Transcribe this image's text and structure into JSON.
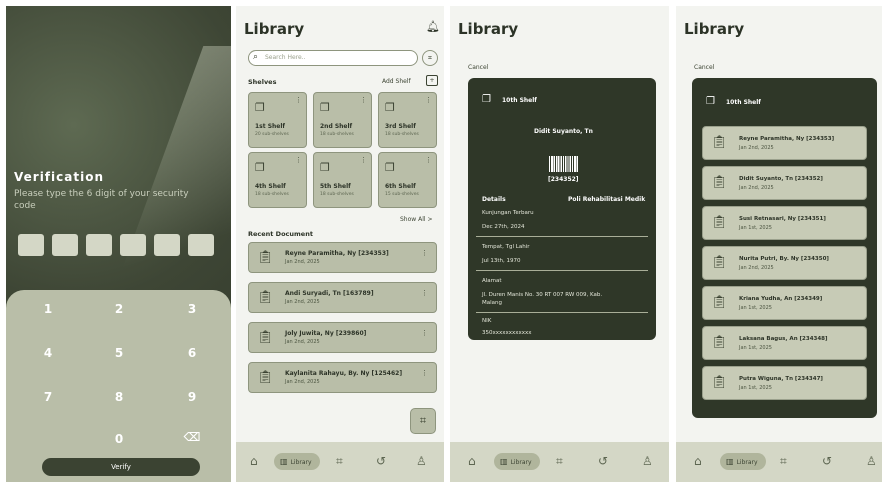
{
  "colors": {
    "dark": "#2f3728",
    "sage": "#b9bea8",
    "light": "#f3f4f0"
  },
  "verification": {
    "title": "Verification",
    "subtitle": "Please type the 6 digit of your security code",
    "keys": [
      "1",
      "2",
      "3",
      "4",
      "5",
      "6",
      "7",
      "8",
      "9",
      "0"
    ],
    "backspace_icon": "⌫",
    "verify_label": "Verify"
  },
  "library": {
    "title": "Library",
    "bell_icon": "♫",
    "search_placeholder": "Search Here..",
    "shelves_label": "Shelves",
    "add_shelf_label": "Add Shelf",
    "shelves": [
      {
        "name": "1st Shelf",
        "sub": "20 sub-shelves"
      },
      {
        "name": "2nd Shelf",
        "sub": "18 sub-shelves"
      },
      {
        "name": "3rd Shelf",
        "sub": "18 sub-shelves"
      },
      {
        "name": "4th Shelf",
        "sub": "18 sub-shelves"
      },
      {
        "name": "5th Shelf",
        "sub": "18 sub-shelves"
      },
      {
        "name": "6th Shelf",
        "sub": "15 sub-shelves"
      }
    ],
    "show_all_label": "Show All >",
    "recent_label": "Recent Document",
    "recent": [
      {
        "name": "Reyne Paramitha, Ny [234353]",
        "date": "Jan 2nd, 2025"
      },
      {
        "name": "Andi Suryadi, Tn [163789]",
        "date": "Jan 2nd, 2025"
      },
      {
        "name": "Joly Juwita, Ny [239860]",
        "date": "Jan 2nd, 2025"
      },
      {
        "name": "Kaylanita Rahayu, By. Ny [125462]",
        "date": "Jan 2nd, 2025"
      }
    ]
  },
  "nav": {
    "library_label": "Library"
  },
  "detail": {
    "cancel": "Cancel",
    "shelf_name": "10th Shelf",
    "patient": "Didit Suyanto, Tn",
    "code": "[234352]",
    "details_label": "Details",
    "department": "Poli Rehabilitasi Medik",
    "fields": [
      {
        "label": "Kunjungan Terbaru",
        "value": "Dec 27th, 2024"
      },
      {
        "label": "Tempat, Tgl Lahir",
        "value": "Jul 13th, 1970"
      },
      {
        "label": "Alamat",
        "value": "Jl. Duren Manis No. 30 RT 007 RW 009, Kab.",
        "value2": "Malang"
      },
      {
        "label": "NIK",
        "value": "350xxxxxxxxxxxx"
      }
    ]
  },
  "shelf_list": {
    "cancel": "Cancel",
    "shelf_name": "10th Shelf",
    "patients": [
      {
        "name": "Reyne Paramitha, Ny [234353]",
        "date": "Jan 2nd, 2025"
      },
      {
        "name": "Didit Suyanto, Tn [234352]",
        "date": "Jan 2nd, 2025"
      },
      {
        "name": "Susi Retnasari, Ny [234351]",
        "date": "Jan 1st, 2025"
      },
      {
        "name": "Nurita Putri, By. Ny [234350]",
        "date": "Jan 2nd, 2025"
      },
      {
        "name": "Kriana Yudha, An [234349]",
        "date": "Jan 1st, 2025"
      },
      {
        "name": "Laksana Bagus, An [234348]",
        "date": "Jan 1st, 2025"
      },
      {
        "name": "Putra Wiguna, Tn [234347]",
        "date": "Jan 1st, 2025"
      }
    ]
  }
}
